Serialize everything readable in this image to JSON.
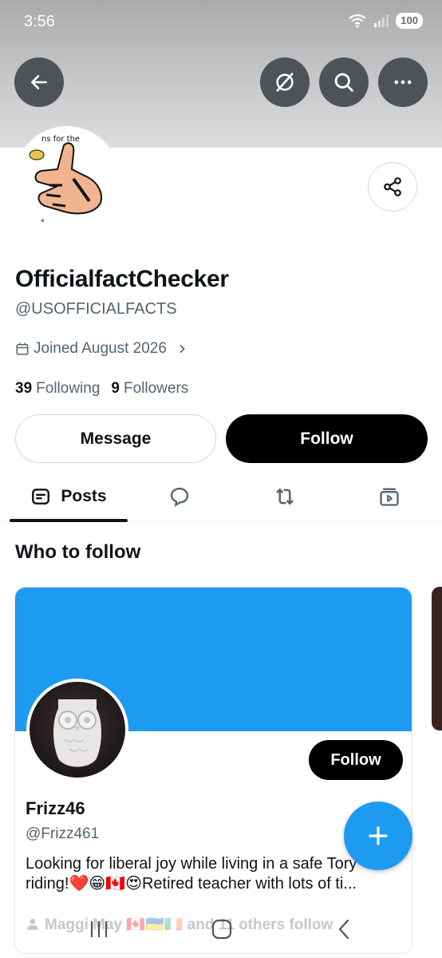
{
  "status": {
    "time": "3:56",
    "battery": "100",
    "wifi_badge": "5"
  },
  "header": {
    "back_icon": "arrow-left-icon",
    "grok_icon": "slash-circle-icon",
    "search_icon": "search-icon",
    "more_icon": "more-horizontal-icon",
    "banner_color": "#b8b9ba"
  },
  "profile": {
    "avatar_text_top": "ns for the",
    "avatar_text_bottom": "rd",
    "display_name": "OfficialfactChecker",
    "handle": "@USOFFICIALFACTS",
    "joined": "Joined August 2026",
    "following_count": "39",
    "following_label": "Following",
    "followers_count": "9",
    "followers_label": "Followers",
    "message_label": "Message",
    "follow_label": "Follow"
  },
  "tabs": {
    "posts_label": "Posts"
  },
  "who_to_follow": {
    "title": "Who to follow",
    "card": {
      "banner_color": "#1d9bf0",
      "name": "Frizz46",
      "handle": "@Frizz461",
      "bio": "Looking for liberal joy while living in a safe Tory riding!❤️😁🇨🇦😍Retired teacher with lots of ti...",
      "follow_label": "Follow",
      "followed_by": "Maggi May 🇨🇦🇺🇦🇮🇪 and 11 others follow"
    }
  },
  "colors": {
    "accent": "#1d9bf0",
    "text_primary": "#0f1419",
    "text_secondary": "#536471"
  }
}
